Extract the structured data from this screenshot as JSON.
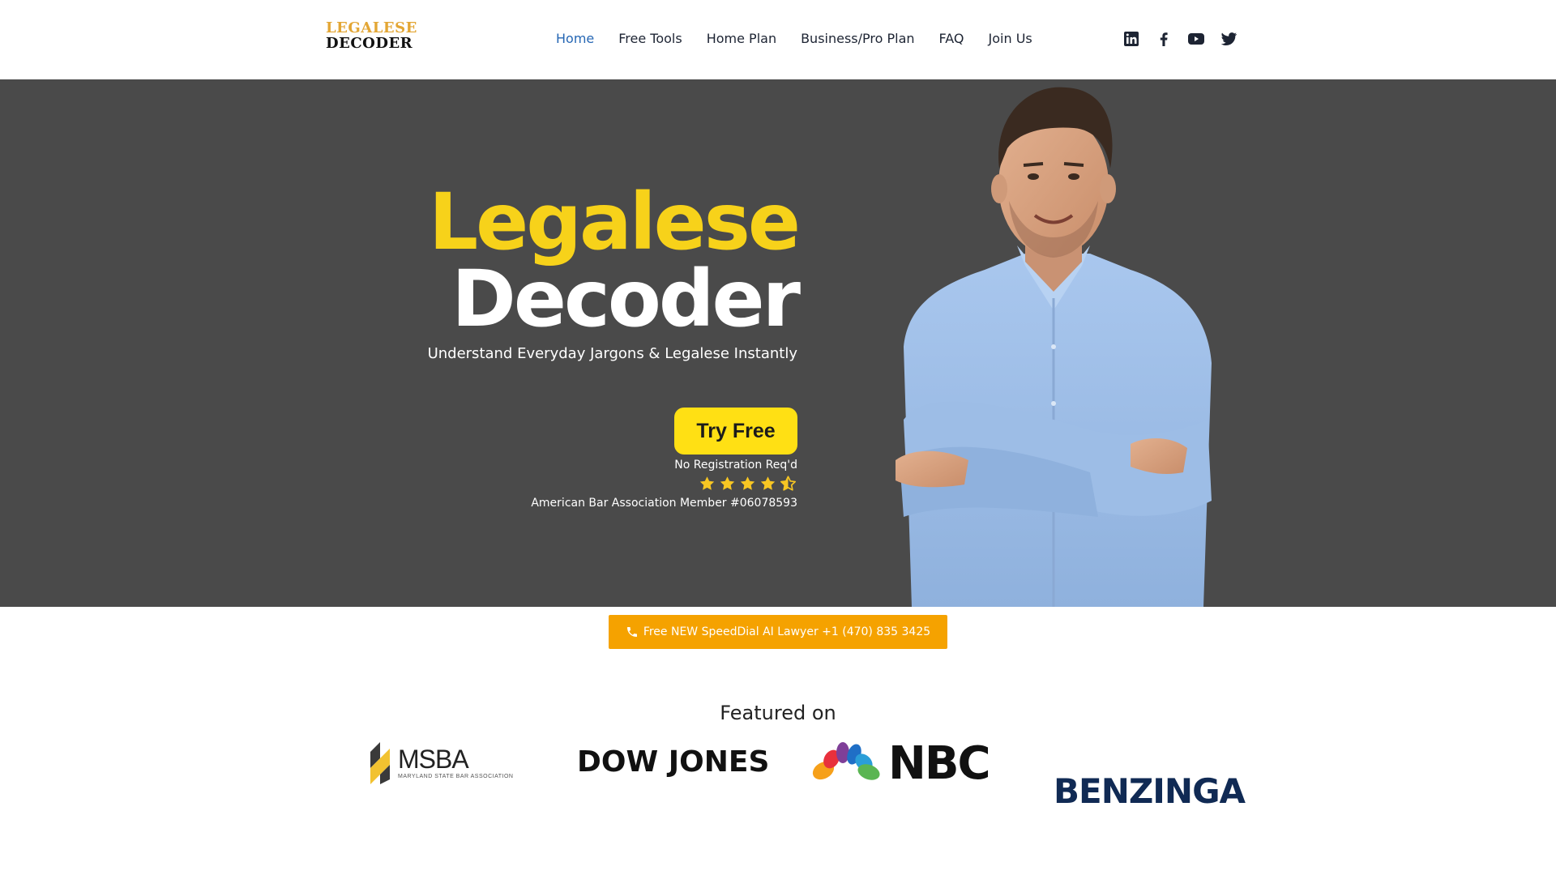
{
  "header": {
    "logo_top": "LEGALESE",
    "logo_bottom": "DECODER",
    "nav": [
      {
        "label": "Home",
        "active": true
      },
      {
        "label": "Free Tools"
      },
      {
        "label": "Home Plan"
      },
      {
        "label": "Business/Pro Plan"
      },
      {
        "label": "FAQ"
      },
      {
        "label": "Join Us"
      }
    ],
    "social_icons": [
      "linkedin-icon",
      "facebook-icon",
      "youtube-icon",
      "twitter-icon"
    ]
  },
  "hero": {
    "title_line1": "Legalese",
    "title_line2": "Decoder",
    "subtitle": "Understand Everyday Jargons & Legalese Instantly",
    "cta_label": "Try Free",
    "no_registration": "No Registration Req'd",
    "rating": 4.5,
    "rating_max": 5,
    "membership": "American Bar Association Member #06078593"
  },
  "speed_dial": {
    "label": "Free NEW SpeedDial AI Lawyer +1 (470) 835 3425",
    "icon": "phone-icon"
  },
  "featured": {
    "heading": "Featured on",
    "brands": {
      "msba": {
        "name": "MSBA",
        "tagline": "MARYLAND STATE BAR ASSOCIATION"
      },
      "dowjones": {
        "name": "DOW JONES"
      },
      "nbc": {
        "name": "NBC"
      },
      "benzinga": {
        "name": "BENZINGA"
      }
    }
  },
  "colors": {
    "accent_blue": "#2667b4",
    "hero_bg": "#4a4a4a",
    "title_yellow": "#f7d21a",
    "cta_yellow": "#ffe014",
    "speed_dial_orange": "#f5a200",
    "star": "#f7c623",
    "benzinga_navy": "#102a54"
  }
}
